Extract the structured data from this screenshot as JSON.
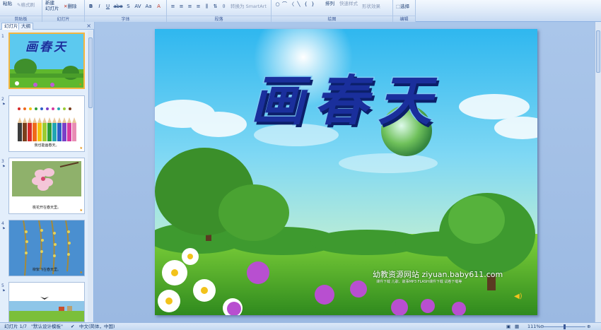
{
  "ribbon": {
    "clipboard": {
      "paste": "粘贴",
      "format_painter": "格式刷",
      "label": "剪贴板"
    },
    "slides": {
      "new_slide_line1": "新建",
      "new_slide_line2": "幻灯片",
      "delete": "删除",
      "label": "幻灯片"
    },
    "font": {
      "label": "字体",
      "tools": [
        "B",
        "I",
        "U",
        "abe",
        "S",
        "AV",
        "Aa",
        "A"
      ]
    },
    "paragraph": {
      "label": "段落",
      "convert_smartart": "转换为 SmartArt"
    },
    "drawing": {
      "label": "绘图",
      "arrange": "排列",
      "quick_styles": "快速样式",
      "shape_effects": "形状效果"
    },
    "editing": {
      "label": "编辑",
      "select": "选择"
    }
  },
  "pane": {
    "tabs": [
      "幻灯片",
      "大纲"
    ],
    "close": "×",
    "slides": [
      {
        "num": "1",
        "caption": "",
        "title": "画春天"
      },
      {
        "num": "2",
        "caption": "我也能画春天。"
      },
      {
        "num": "3",
        "caption": "桃花开在春天里。"
      },
      {
        "num": "4",
        "caption": "柳絮飞在春天里。"
      },
      {
        "num": "5",
        "caption": ""
      }
    ]
  },
  "slide": {
    "title": "画春天",
    "watermark_main": "幼教资源网站 ziyuan.baby611.com",
    "watermark_sub": "课件下载  儿歌、故事MP3  FLASH课件下载  试卷下载等"
  },
  "status": {
    "slide_index": "幻灯片 1/7",
    "theme": "\"默认设计模板\"",
    "language": "中文(简体，中国)",
    "zoom": "111%",
    "zoom_minus": "⊖",
    "zoom_plus": "⊕"
  },
  "colors": {
    "accent": "#15428b",
    "title_fill": "#1a2f9c",
    "title_outline": "#7cc9f3"
  }
}
